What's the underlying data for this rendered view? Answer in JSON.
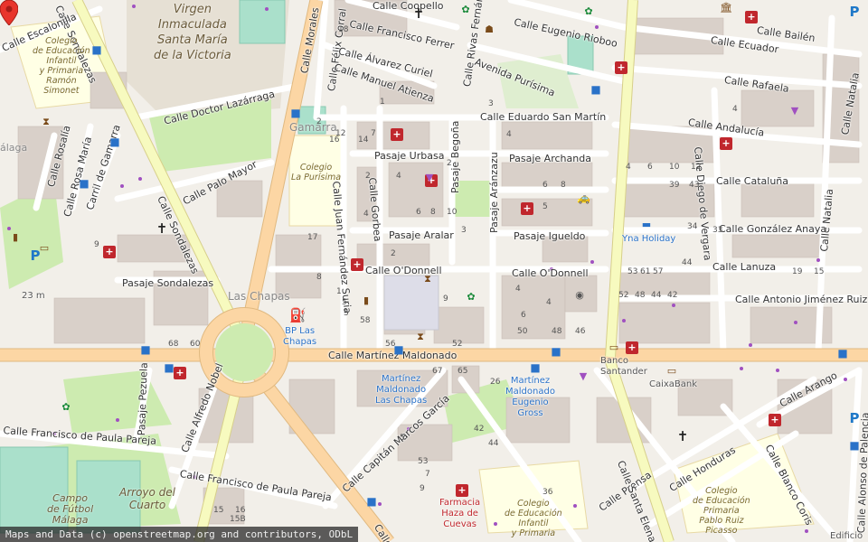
{
  "attribution": "Maps and Data (c) openstreetmap.org and contributors, ODbL",
  "streets": {
    "sondalezas": "Calle Sondalezas",
    "sondalezas_n": "Calle Sondalezas",
    "morales": "Calle Morales",
    "felix_corral": "Calle Félix Corral",
    "coopello": "Calle Coopello",
    "francisco_ferrer": "Calle Francisco Ferrer",
    "alvarez_curiel": "Calle Álvarez Curiel",
    "manuel_atienza": "Calle Manuel Atienza",
    "rivas_fernandez": "Calle Rivas Fernández",
    "eugenio_rioboo": "Calle Eugenio Rioboo",
    "avenida_purisima": "Avenida Purísima",
    "eduardo_san_martin": "Calle Eduardo San Martín",
    "doctor_lazarraga": "Calle Doctor Lazárraga",
    "palo_mayor": "Calle Palo Mayor",
    "rosalia": "Calle Rosalía",
    "rosa_maria": "Calle Rosa María",
    "carril_gamarra": "Carril de Gamarra",
    "escalonilla": "Calle Escalonilla",
    "juan_fernandez_suria": "Calle Juan Fernández Suria",
    "gorbea": "Calle Gorbea",
    "pasaje_urbasa": "Pasaje Urbasa",
    "pasaje_begona": "Pasaje Begoña",
    "pasaje_aralar": "Pasaje Aralar",
    "pasaje_aranzazu": "Pasaje Aránzazu",
    "pasaje_archanda": "Pasaje Archanda",
    "pasaje_igueldo": "Pasaje Igueldo",
    "odonnell_w": "Calle O'Donnell",
    "odonnell_e": "Calle O'Donnell",
    "pasaje_sondalezas": "Pasaje Sondalezas",
    "martinez_maldonado": "Calle Martínez Maldonado",
    "ecuador": "Calle Ecuador",
    "bailen": "Calle Bailén",
    "rafaela": "Calle Rafaela",
    "andalucia": "Calle Andalucía",
    "natalia": "Calle Natalia",
    "natalia_s": "Calle Natalia",
    "cataluna": "Calle Cataluña",
    "diego_vergara": "Calle Diego de Vergara",
    "gonzalez_anaya": "Calle González Anaya",
    "lanuza": "Calle Lanuza",
    "antonio_jimenez_ruiz": "Calle Antonio Jiménez Ruiz",
    "arango": "Calle Arango",
    "honduras": "Calle Honduras",
    "blanco_coris": "Calle Blanco Coris",
    "alonso_palencia": "Calle Alonso de Palencia",
    "prensa": "Calle Prensa",
    "santa_elena": "Calle Santa Elena",
    "pezuela": "Pasaje Pezuela",
    "alfredo_nobel": "Calle Alfredo Nobel",
    "francisco_paula_pareja": "Calle Francisco de Paula Pareja",
    "francisco_paula_pareja_2": "Calle Francisco de Paula Pareja",
    "capitan_marcos_garcia": "Calle Capitán Marcos García",
    "calle_la": "Calle La"
  },
  "areas": {
    "virgen": "Virgen\nInmaculada\nSanta María\nde la Victoria",
    "gamarra": "Gamarra",
    "las_chapas": "Las Chapas",
    "arroyo": "Arroyo del\nCuarto",
    "malaga": "álaga",
    "campo": "Campo\nde Fútbol\nMálaga"
  },
  "schools": {
    "ramon_simonet": "Colegio\nde Educación\nInfantil\ny Primaria\nRamón\nSimonet",
    "la_purisima": "Colegio\nLa Purísima",
    "pablo_ruiz_picasso": "Colegio\nde Educación\nPrimaria\nPablo Ruiz\nPicasso",
    "colegio_s": "Colegio\nde Educación\nInfantil\ny Primaria"
  },
  "bus_stops": {
    "bp": "BP Las\nChapas",
    "mm_chapas": "Martínez\nMaldonado\nLas Chapas",
    "mm_eugenio": "Martínez\nMaldonado\nEugenio\nGross",
    "yna": "Yna Holiday"
  },
  "pois": {
    "banco": "Banco\nSantander",
    "caixabank": "CaixaBank",
    "edificio": "Edificio",
    "elevation": "23 m"
  },
  "pharmacy_label": "Farmacia\nHaza de\nCuevas",
  "house_numbers": [
    "12",
    "7",
    "2",
    "4",
    "6",
    "8",
    "10",
    "17",
    "2",
    "5",
    "4",
    "6",
    "8",
    "4",
    "5",
    "3",
    "9",
    "6",
    "4",
    "1",
    "5",
    "2",
    "4",
    "3",
    "9",
    "8",
    "58",
    "56",
    "52",
    "50",
    "48",
    "46",
    "68",
    "60",
    "67",
    "65",
    "26",
    "4",
    "6",
    "10",
    "12",
    "39",
    "43",
    "34",
    "44",
    "57",
    "53",
    "61",
    "19",
    "15",
    "52",
    "48",
    "44",
    "42",
    "33",
    "2",
    "1",
    "16",
    "14",
    "18",
    "15",
    "16",
    "15B",
    "53",
    "5",
    "7",
    "9",
    "44",
    "42",
    "36",
    "4"
  ],
  "colors": {
    "background": "#f2efe9",
    "primary_road": "#fcd6a4",
    "secondary_road": "#f7fabf",
    "building": "#d9d0c9",
    "park": "#cdebb0",
    "pitch": "#aae0cb",
    "school": "#ffffe5",
    "pin": "#e8352c"
  }
}
